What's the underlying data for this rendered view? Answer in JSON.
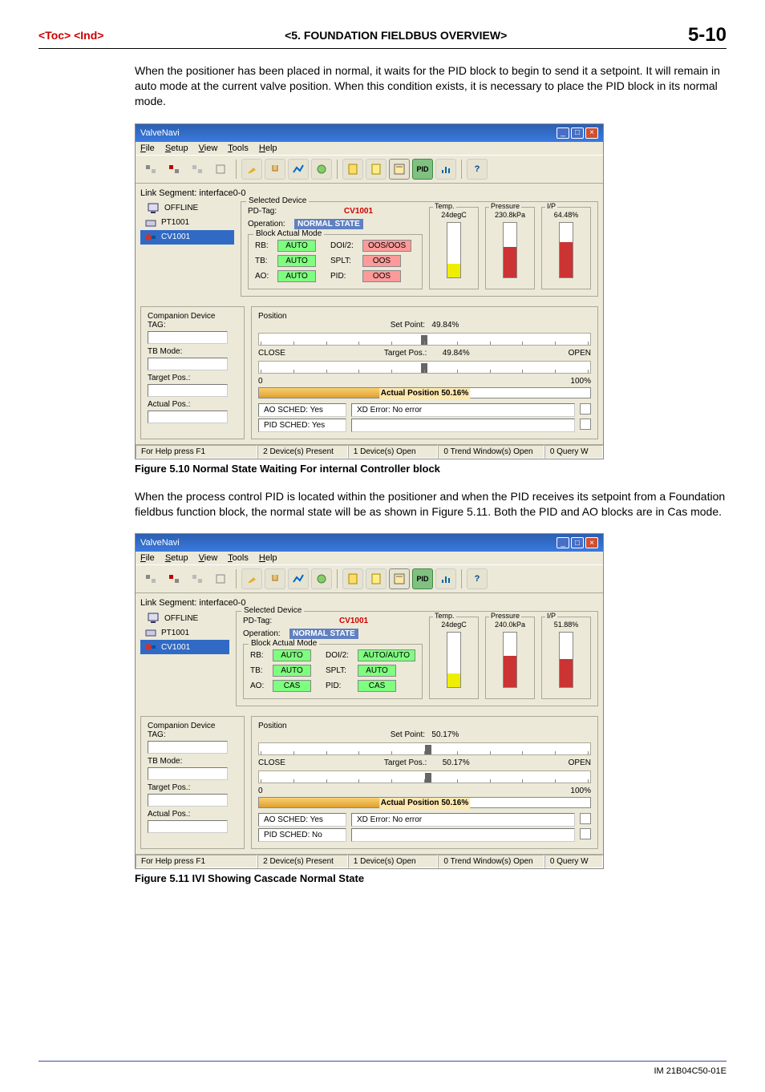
{
  "header": {
    "left": "<Toc> <Ind>",
    "center": "<5.  FOUNDATION FIELDBUS OVERVIEW>",
    "right": "5-10"
  },
  "para1": "When the positioner has been placed in normal, it waits for the PID block to begin to send it a setpoint.  It will remain in auto mode at the current valve position.  When this condition exists, it is necessary to place the PID block in its normal mode.",
  "caption1": "Figure 5.10 Normal State Waiting For internal Controller block",
  "para2": "When the process control PID is located within the positioner and when the PID receives its setpoint from a Foundation fieldbus function block, the normal state will be as shown in Figure 5.11.  Both the PID and AO blocks are in Cas mode.",
  "caption2": "Figure 5.11 IVI Showing Cascade Normal State",
  "window": {
    "title": "ValveNavi",
    "menu": {
      "file": "File",
      "setup": "Setup",
      "view": "View",
      "tools": "Tools",
      "help": "Help"
    },
    "link_segment": "Link Segment: interface0-0",
    "tree": {
      "offline": "OFFLINE",
      "pt": "PT1001",
      "cv": "CV1001"
    },
    "selected_device": {
      "legend": "Selected Device",
      "pd_tag_label": "PD-Tag:",
      "pd_tag": "CV1001",
      "operation_label": "Operation:",
      "operation": "NORMAL STATE",
      "bam_legend": "Block Actual Mode",
      "rb": "RB:",
      "tb": "TB:",
      "ao": "AO:",
      "doi2": "DOI/2:",
      "splt": "SPLT:",
      "pid": "PID:"
    },
    "gauges": {
      "temp": "Temp.",
      "temp_val": "24degC",
      "pressure": "Pressure",
      "pressure_val": "230.8kPa",
      "ip": "I/P",
      "ip_val1": "64.48%",
      "ip_val2": "51.88%",
      "pressure_val2": "240.0kPa"
    },
    "companion": {
      "legend": "Companion Device",
      "tag": "TAG:",
      "tb_mode": "TB Mode:",
      "target": "Target Pos.:",
      "actual": "Actual Pos.:"
    },
    "position": {
      "legend": "Position",
      "setpoint_label": "Set Point:",
      "close": "CLOSE",
      "open": "OPEN",
      "target_label": "Target Pos.:",
      "zero": "0",
      "hundred": "100%",
      "actual_label1": "Actual Position 50.16%",
      "actual_label2": "Actual Position 50.16%"
    },
    "fig1": {
      "rb_state": "AUTO",
      "tb_state": "AUTO",
      "ao_state": "AUTO",
      "doi_state": "OOS/OOS",
      "splt_state": "OOS",
      "pid_state": "OOS",
      "setpoint": "49.84%",
      "target": "49.84%",
      "ao_sched": "AO SCHED: Yes",
      "pid_sched": "PID SCHED: Yes",
      "xd_error": "XD Error: No error"
    },
    "fig2": {
      "rb_state": "AUTO",
      "tb_state": "AUTO",
      "ao_state": "CAS",
      "doi_state": "AUTO/AUTO",
      "splt_state": "AUTO",
      "pid_state": "CAS",
      "setpoint": "50.17%",
      "target": "50.17%",
      "ao_sched": "AO SCHED: Yes",
      "pid_sched": "PID SCHED: No",
      "xd_error": "XD Error: No error"
    },
    "statusbar": {
      "help": "For Help press F1",
      "dev_present": "2 Device(s) Present",
      "dev_open": "1 Device(s) Open",
      "trend": "0 Trend Window(s) Open",
      "query": "0 Query W"
    }
  },
  "footer": "IM 21B04C50-01E"
}
